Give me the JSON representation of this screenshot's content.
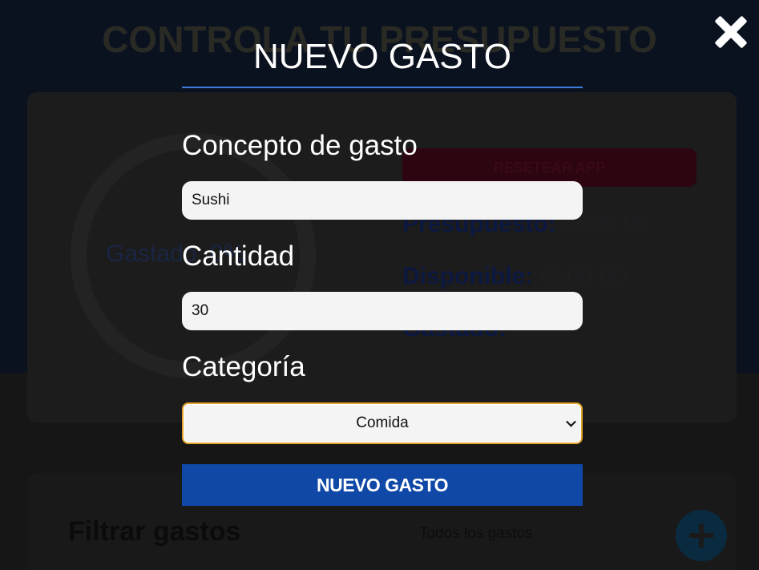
{
  "app": {
    "title": "CONTROLA TU PRESUPUESTO",
    "ring_label": "Gastado: 0%",
    "reset_label": "RESETEAR APP",
    "stats": [
      {
        "label": "Presupuesto:",
        "value": "€500.00"
      },
      {
        "label": "Disponible:",
        "value": "€500.00"
      },
      {
        "label": "Gastado:",
        "value": "€0.00"
      }
    ],
    "filter_title": "Filtrar gastos",
    "filter_value": "Todos los gastos",
    "add_icon": "plus-icon"
  },
  "modal": {
    "close_icon": "close-icon",
    "title": "NUEVO GASTO",
    "concepto_label": "Concepto de gasto",
    "concepto_value": "Sushi",
    "cantidad_label": "Cantidad",
    "cantidad_value": "30",
    "categoria_label": "Categoría",
    "categoria_value": "Comida",
    "submit_label": "NUEVO GASTO"
  },
  "colors": {
    "accent": "#3d7ee0",
    "submit": "#1048a8",
    "focus_ring": "#e2a32a"
  }
}
